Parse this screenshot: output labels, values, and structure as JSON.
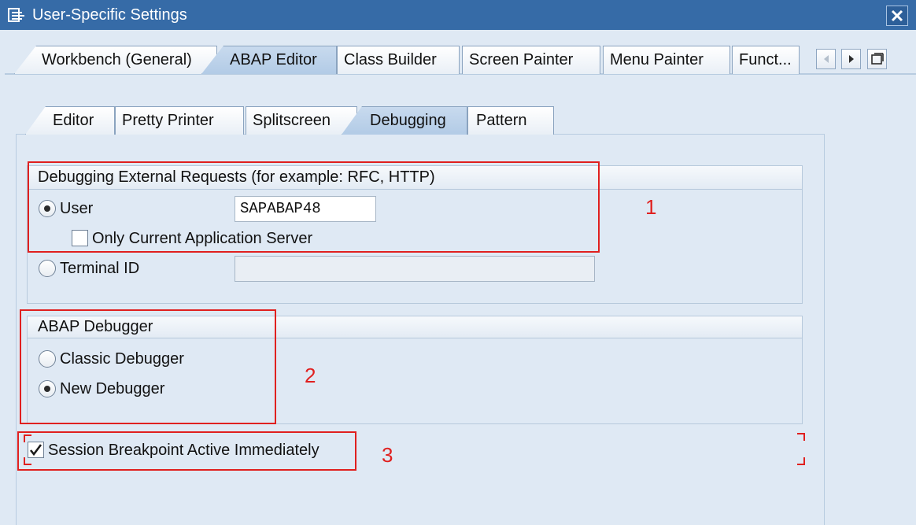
{
  "window": {
    "title": "User-Specific Settings",
    "title_icon": "settings-window-icon",
    "close_icon": "close-icon"
  },
  "main_tabs": [
    {
      "label": "Workbench (General)",
      "active": false
    },
    {
      "label": "ABAP Editor",
      "active": true
    },
    {
      "label": "Class Builder",
      "active": false
    },
    {
      "label": "Screen Painter",
      "active": false
    },
    {
      "label": "Menu Painter",
      "active": false
    },
    {
      "label": "Funct...",
      "active": false
    }
  ],
  "tab_nav": {
    "prev_icon": "triangle-left-icon",
    "next_icon": "triangle-right-icon",
    "list_icon": "tab-list-icon"
  },
  "sub_tabs": [
    {
      "label": "Editor",
      "active": false
    },
    {
      "label": "Pretty Printer",
      "active": false
    },
    {
      "label": "Splitscreen",
      "active": false
    },
    {
      "label": "Debugging",
      "active": true
    },
    {
      "label": "Pattern",
      "active": false
    }
  ],
  "external_requests": {
    "title": "Debugging External Requests (for example: RFC, HTTP)",
    "user_label": "User",
    "user_selected": true,
    "user_value": "SAPABAP48",
    "only_current_server_label": "Only Current Application Server",
    "only_current_server_checked": false,
    "terminal_label": "Terminal ID",
    "terminal_selected": false,
    "terminal_value": ""
  },
  "abap_debugger": {
    "title": "ABAP Debugger",
    "classic_label": "Classic Debugger",
    "classic_selected": false,
    "new_label": "New Debugger",
    "new_selected": true
  },
  "session_breakpoint": {
    "label": "Session Breakpoint Active Immediately",
    "checked": true
  },
  "annotations": {
    "one": "1",
    "two": "2",
    "three": "3"
  },
  "colors": {
    "titlebar": "#366ba7",
    "background": "#dfe9f4",
    "annotation": "#e0201f"
  }
}
